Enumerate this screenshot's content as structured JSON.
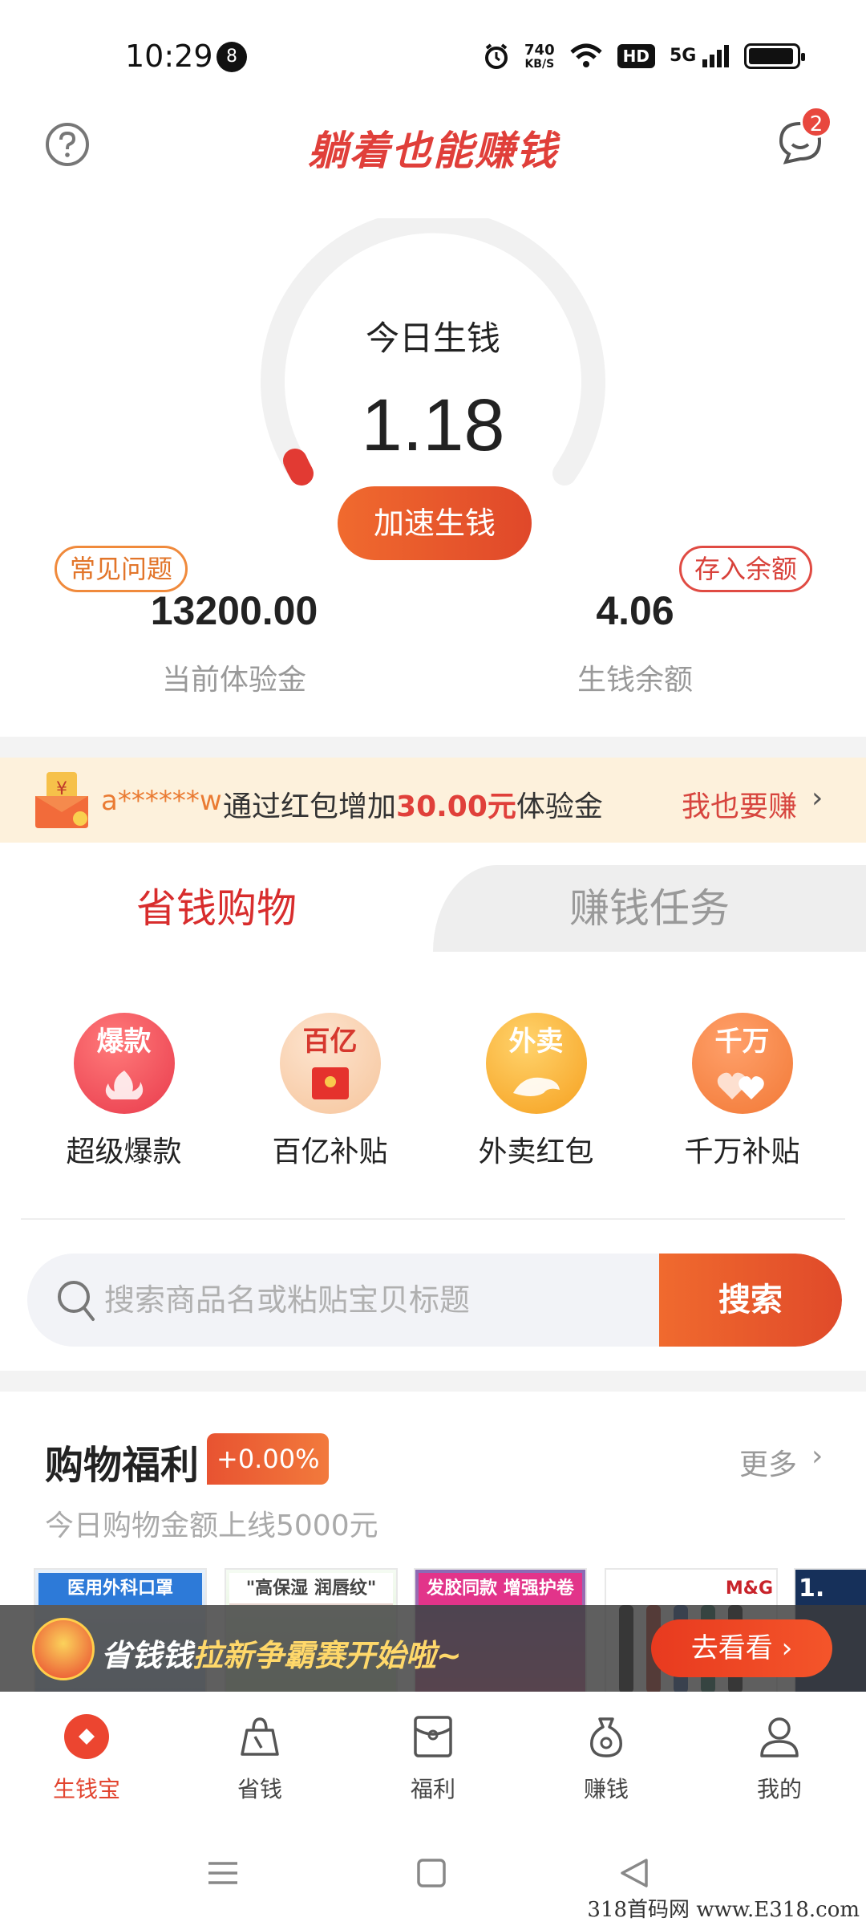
{
  "status_bar": {
    "time": "10:29",
    "notification_count": "8",
    "net_speed_value": "740",
    "net_speed_unit": "KB/S",
    "hd_label": "HD",
    "signal_label": "5G",
    "battery_level": 0.95
  },
  "header": {
    "title": "躺着也能赚钱",
    "message_badge": "2",
    "help_icon": "question-circle-icon",
    "message_icon": "chat-bubble-icon"
  },
  "gauge": {
    "label": "今日生钱",
    "value": "1.18",
    "speed_button": "加速生钱",
    "track_color": "#f1f1f1",
    "indicator_color": "#e23a33"
  },
  "shortcuts": {
    "faq": "常见问题",
    "deposit": "存入余额"
  },
  "stats": {
    "trial_amount": "13200.00",
    "trial_label": "当前体验金",
    "balance_amount": "4.06",
    "balance_label": "生钱余额"
  },
  "ticker": {
    "user": "a******w",
    "text_prefix": "通过红包增加",
    "amount": "30.00元",
    "text_suffix": "体验金",
    "cta": "我也要赚"
  },
  "tabs": [
    {
      "label": "省钱购物",
      "active": true
    },
    {
      "label": "赚钱任务",
      "active": false
    }
  ],
  "categories": [
    {
      "icon_text": "爆款",
      "label": "超级爆款",
      "icon": "fire-icon"
    },
    {
      "icon_text": "百亿",
      "label": "百亿补贴",
      "icon": "red-envelope-icon"
    },
    {
      "icon_text": "外卖",
      "label": "外卖红包",
      "icon": "delivery-icon"
    },
    {
      "icon_text": "千万",
      "label": "千万补贴",
      "icon": "hearts-icon"
    }
  ],
  "search": {
    "placeholder": "搜索商品名或粘贴宝贝标题",
    "button": "搜索"
  },
  "shopping_welfare": {
    "title": "购物福利",
    "badge": "+0.00%",
    "more": "更多",
    "subtitle": "今日购物金额上线5000元"
  },
  "products": [
    {
      "caption": "医用外科口罩"
    },
    {
      "caption": "\"高保湿 润唇纹\""
    },
    {
      "caption": "发胶同款 增强护卷"
    },
    {
      "caption": "M&G"
    },
    {
      "caption": "1."
    }
  ],
  "promo": {
    "text_a": "省钱钱",
    "text_b": "拉新争霸赛开始啦~",
    "button": "去看看"
  },
  "bottom_nav": [
    {
      "label": "生钱宝",
      "active": true,
      "icon": "coin-diamond-icon"
    },
    {
      "label": "省钱",
      "active": false,
      "icon": "shopping-bag-icon"
    },
    {
      "label": "福利",
      "active": false,
      "icon": "envelope-icon"
    },
    {
      "label": "赚钱",
      "active": false,
      "icon": "money-bag-icon"
    },
    {
      "label": "我的",
      "active": false,
      "icon": "user-icon"
    }
  ],
  "watermark": "318首码网 www.E318.com"
}
